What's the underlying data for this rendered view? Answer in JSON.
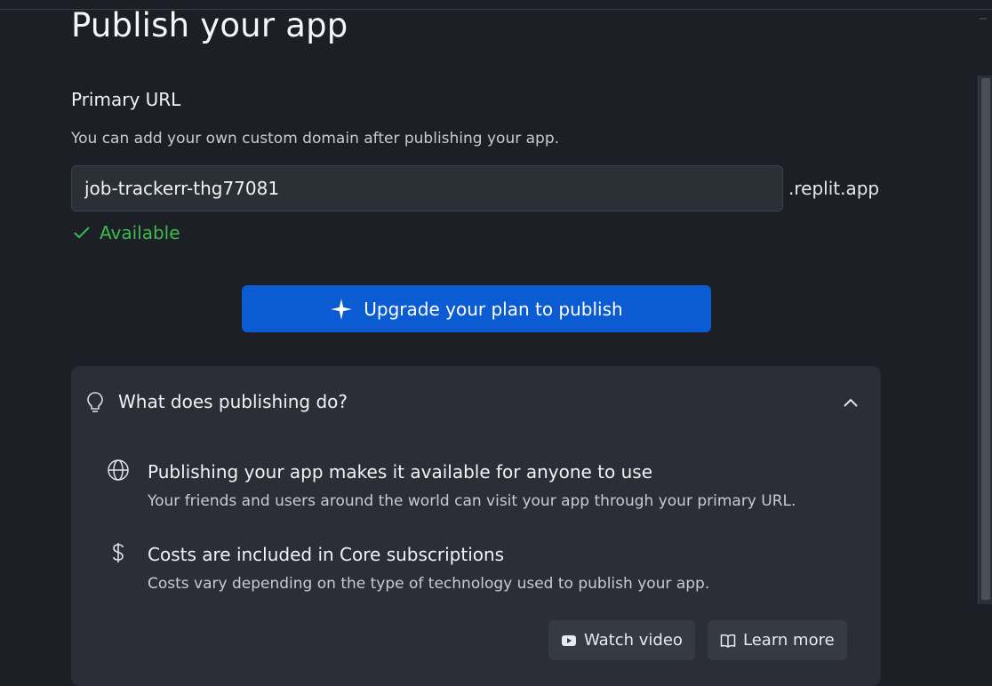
{
  "page": {
    "title": "Publish your app"
  },
  "primary_url": {
    "label": "Primary URL",
    "helper": "You can add your own custom domain after publishing your app.",
    "value": "job-trackerr-thg77081",
    "suffix": ".replit.app",
    "status": "Available",
    "status_color": "#3fba50"
  },
  "upgrade": {
    "label": "Upgrade your plan to publish",
    "icon": "sparkle-icon",
    "color": "#0b5bd3"
  },
  "faq": {
    "question": "What does publishing do?",
    "items": [
      {
        "icon": "globe-icon",
        "title": "Publishing your app makes it available for anyone to use",
        "desc": "Your friends and users around the world can visit your app through your primary URL."
      },
      {
        "icon": "dollar-icon",
        "title": "Costs are included in Core subscriptions",
        "desc": "Costs vary depending on the type of technology used to publish your app."
      }
    ],
    "watch_label": "Watch video",
    "learn_label": "Learn more"
  }
}
